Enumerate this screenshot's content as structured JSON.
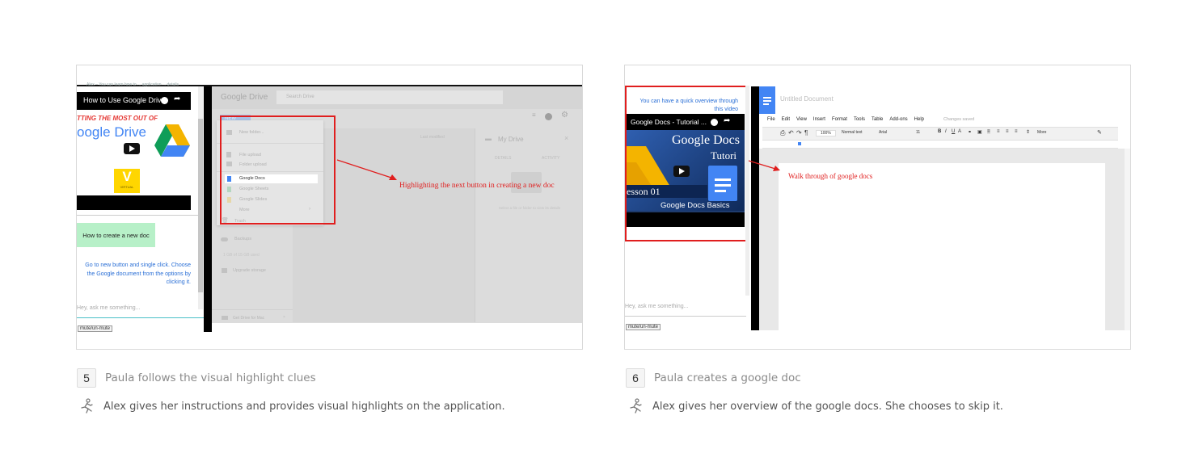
{
  "left": {
    "top_cut_text": "Alex – You can learn how to ... application ... details",
    "video_title": "How to Use Google Driv...",
    "video_banner": "TTING THE MOST OUT OF",
    "video_brand": "oogle Drive",
    "video_logo_letter": "V",
    "video_logo_sub": "VIRTUAL",
    "bubble_text": "How to create a new doc",
    "instruction_text": "Go to new button and single click. Choose the Google document from the options by clicking it.",
    "chat_placeholder": "Hey, ask me something...",
    "mute_label": "mute/un-mute",
    "drive": {
      "logo": "Google Drive",
      "search_placeholder": "Search Drive",
      "new_label": "NEW",
      "my_drive": "My Drive",
      "last_modified": "Last modified",
      "menu_items": [
        "New folder...",
        "File upload",
        "Folder upload",
        "Google Docs",
        "Google Sheets",
        "Google Slides",
        "More"
      ],
      "side_items": [
        "Trash",
        "Backups",
        "1 GB of 15 GB used",
        "Upgrade storage",
        "Get Drive for Mac"
      ],
      "detail_tabs": [
        "DETAILS",
        "ACTIVITY"
      ],
      "detail_hint": "Select a file or folder to view its details"
    },
    "annotation": "Highlighting the next button in creating a new doc"
  },
  "right": {
    "intro_text": "You can have a quick overview through this video",
    "video_title": "Google Docs - Tutorial ...",
    "thumb_brand": "Google Docs",
    "thumb_sub": "Tutori",
    "thumb_lesson": "esson 01",
    "thumb_basics": "Google Docs Basics",
    "chat_placeholder": "Hey, ask me something...",
    "mute_label": "mute/un-mute",
    "docs": {
      "doc_title": "Untitled Document",
      "menus": [
        "File",
        "Edit",
        "View",
        "Insert",
        "Format",
        "Tools",
        "Table",
        "Add-ons",
        "Help"
      ],
      "saved_status": "Changes saved",
      "zoom": "100%",
      "style": "Normal text",
      "font": "Arial",
      "size": "11",
      "more": "More"
    },
    "annotation": "Walk through of google docs"
  },
  "steps": [
    {
      "number": "5",
      "title": "Paula follows the visual highlight clues",
      "description": "Alex gives her instructions and provides visual highlights on the application."
    },
    {
      "number": "6",
      "title": "Paula creates a google doc",
      "description": "Alex gives her overview of the google docs. She chooses to skip it."
    }
  ],
  "colors": {
    "highlight_red": "#e01e1e",
    "drive_blue": "#4285f4",
    "drive_green": "#0f9d58",
    "drive_yellow": "#f4b400",
    "bubble_green": "#b7f0c8",
    "link_blue": "#2a6fd6"
  }
}
